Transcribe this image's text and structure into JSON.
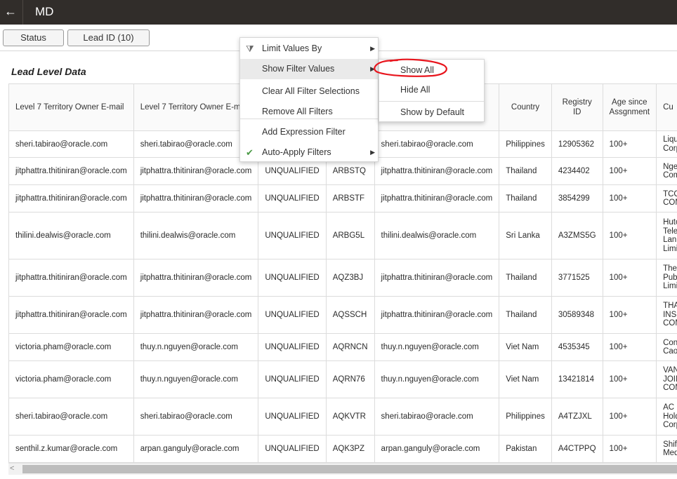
{
  "topbar": {
    "back_icon": "←",
    "title": "MD"
  },
  "filters": {
    "status_label": "Status",
    "lead_id_label": "Lead ID (10)"
  },
  "section_title": "Lead Level Data",
  "table": {
    "headers": [
      "Level 7 Territory Owner E-mail",
      "Level 7 Territory Owner E-m",
      "",
      "",
      "",
      "Country",
      "Registry ID",
      "Age since Assgnment",
      "Cu"
    ],
    "rows": [
      [
        "sheri.tabirao@oracle.com",
        "sheri.tabirao@oracle.com",
        "",
        "",
        "sheri.tabirao@oracle.com",
        "Philippines",
        "12905362",
        "100+",
        "Liqui",
        "Corp"
      ],
      [
        "jitphattra.thitiniran@oracle.com",
        "jitphattra.thitiniran@oracle.com",
        "UNQUALIFIED",
        "ARBSTQ",
        "jitphattra.thitiniran@oracle.com",
        "Thailand",
        "4234402",
        "100+",
        "Nger",
        "Comp"
      ],
      [
        "jitphattra.thitiniran@oracle.com",
        "jitphattra.thitiniran@oracle.com",
        "UNQUALIFIED",
        "ARBSTF",
        "jitphattra.thitiniran@oracle.com",
        "Thailand",
        "3854299",
        "100+",
        "TCC C",
        "COM"
      ],
      [
        "thilini.dealwis@oracle.com",
        "thilini.dealwis@oracle.com",
        "UNQUALIFIED",
        "ARBG5L",
        "thilini.dealwis@oracle.com",
        "Sri Lanka",
        "A3ZMS5G",
        "100+",
        "Hutc",
        "Telec",
        "Lank",
        "Limit"
      ],
      [
        "jitphattra.thitiniran@oracle.com",
        "jitphattra.thitiniran@oracle.com",
        "UNQUALIFIED",
        "AQZ3BJ",
        "jitphattra.thitiniran@oracle.com",
        "Thailand",
        "3771525",
        "100+",
        "The E",
        "Publi",
        "Limit"
      ],
      [
        "jitphattra.thitiniran@oracle.com",
        "jitphattra.thitiniran@oracle.com",
        "UNQUALIFIED",
        "AQSSCH",
        "jitphattra.thitiniran@oracle.com",
        "Thailand",
        "30589348",
        "100+",
        "THAI",
        "INSU",
        "COM"
      ],
      [
        "victoria.pham@oracle.com",
        "thuy.n.nguyen@oracle.com",
        "UNQUALIFIED",
        "AQRNCN",
        "thuy.n.nguyen@oracle.com",
        "Viet Nam",
        "4535345",
        "100+",
        "Cong",
        "Cao S"
      ],
      [
        "victoria.pham@oracle.com",
        "thuy.n.nguyen@oracle.com",
        "UNQUALIFIED",
        "AQRN76",
        "thuy.n.nguyen@oracle.com",
        "Viet Nam",
        "13421814",
        "100+",
        "VAN",
        "JOIN",
        "COM"
      ],
      [
        "sheri.tabirao@oracle.com",
        "sheri.tabirao@oracle.com",
        "UNQUALIFIED",
        "AQKVTR",
        "sheri.tabirao@oracle.com",
        "Philippines",
        "A4TZJXL",
        "100+",
        "AC In",
        "Holdi",
        "Corp"
      ],
      [
        "senthil.z.kumar@oracle.com",
        "arpan.ganguly@oracle.com",
        "UNQUALIFIED",
        "AQK3PZ",
        "arpan.ganguly@oracle.com",
        "Pakistan",
        "A4CTPPQ",
        "100+",
        "Shifa",
        "Medi"
      ]
    ]
  },
  "context_menu": {
    "items": [
      "Limit Values By",
      "Show Filter Values",
      "Clear All Filter Selections",
      "Remove All Filters",
      "Add Expression Filter",
      "Auto-Apply Filters"
    ],
    "submenu_arrow": "▶",
    "filter_icon": "⧩",
    "check_icon": "✔"
  },
  "submenu": {
    "items": [
      "Show All",
      "Hide All",
      "Show by Default"
    ]
  },
  "scrollbar": {
    "left_arrow": "<"
  },
  "colors": {
    "topbar": "#312d2a",
    "annotation": "#e8141c",
    "check": "#4a9a45"
  }
}
